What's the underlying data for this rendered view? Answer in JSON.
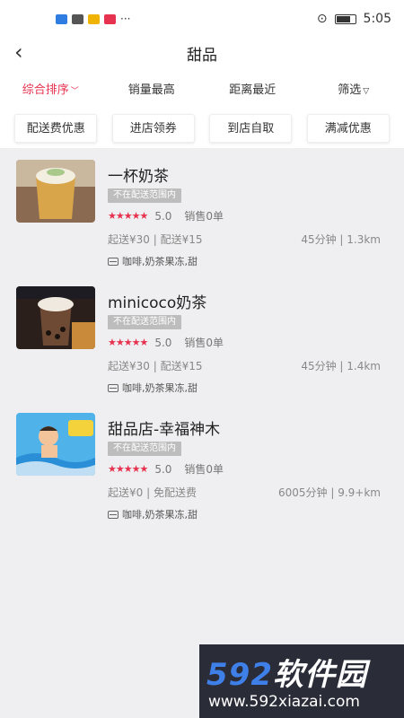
{
  "statusbar": {
    "time": "5:05"
  },
  "header": {
    "back_icon": "back-arrow-icon",
    "title": "甜品"
  },
  "sort_tabs": [
    {
      "label": "综合排序",
      "active": true,
      "suffix": "chevron-down"
    },
    {
      "label": "销量最高",
      "active": false
    },
    {
      "label": "距离最近",
      "active": false
    },
    {
      "label": "筛选",
      "active": false,
      "suffix": "filter"
    }
  ],
  "chips": [
    "配送费优惠",
    "进店领券",
    "到店自取",
    "满减优惠"
  ],
  "shops": [
    {
      "name": "一杯奶茶",
      "tag": "不在配送范围内",
      "rating": "5.0",
      "sales": "销售0单",
      "fees": "起送¥30 | 配送¥15",
      "distance": "45分钟 | 1.3km",
      "categories": "咖啡,奶茶果冻,甜"
    },
    {
      "name": "minicoco奶茶",
      "tag": "不在配送范围内",
      "rating": "5.0",
      "sales": "销售0单",
      "fees": "起送¥30 | 配送¥15",
      "distance": "45分钟 | 1.4km",
      "categories": "咖啡,奶茶果冻,甜"
    },
    {
      "name": "甜品店-幸福神木",
      "tag": "不在配送范围内",
      "rating": "5.0",
      "sales": "销售0单",
      "fees": "起送¥0 | 免配送费",
      "distance": "6005分钟 | 9.9+km",
      "categories": "咖啡,奶茶果冻,甜"
    }
  ],
  "colors": {
    "accent": "#e6314f",
    "tag_bg": "#bdbdbd",
    "page_bg": "#efeff1"
  },
  "watermark": {
    "brand_num": "592",
    "brand_text": "软件园",
    "url": "www.592xiazai.com"
  }
}
